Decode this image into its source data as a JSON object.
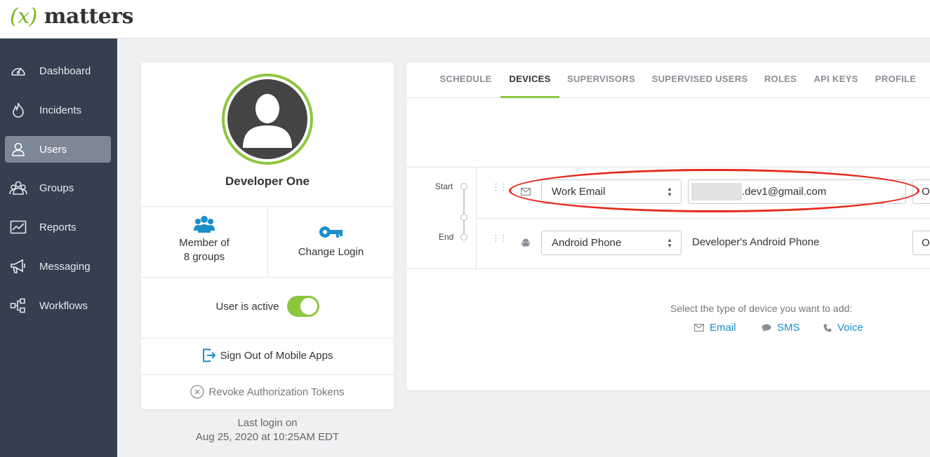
{
  "brand": {
    "logo_prefix": "(x)",
    "logo_text": "matters",
    "accent_color": "#8cc63f"
  },
  "sidebar": {
    "items": [
      {
        "label": "Dashboard",
        "icon": "dashboard-icon",
        "active": false
      },
      {
        "label": "Incidents",
        "icon": "flame-icon",
        "active": false
      },
      {
        "label": "Users",
        "icon": "user-icon",
        "active": true
      },
      {
        "label": "Groups",
        "icon": "groups-icon",
        "active": false
      },
      {
        "label": "Reports",
        "icon": "chart-icon",
        "active": false
      },
      {
        "label": "Messaging",
        "icon": "megaphone-icon",
        "active": false
      },
      {
        "label": "Workflows",
        "icon": "workflow-icon",
        "active": false
      }
    ]
  },
  "profile": {
    "name": "Developer One",
    "groups_line1": "Member of",
    "groups_line2": "8 groups",
    "change_login": "Change Login",
    "active_label": "User is active",
    "active": true,
    "sign_out_mobile": "Sign Out of Mobile Apps",
    "revoke_tokens": "Revoke Authorization Tokens",
    "last_login_line1": "Last login on",
    "last_login_line2": "Aug 25, 2020 at 10:25AM EDT"
  },
  "tabs": [
    {
      "label": "SCHEDULE",
      "active": false
    },
    {
      "label": "DEVICES",
      "active": true
    },
    {
      "label": "SUPERVISORS",
      "active": false
    },
    {
      "label": "SUPERVISED USERS",
      "active": false
    },
    {
      "label": "ROLES",
      "active": false
    },
    {
      "label": "API KEYS",
      "active": false
    },
    {
      "label": "PROFILE",
      "active": false
    }
  ],
  "timeline": {
    "start_label": "Start",
    "end_label": "End"
  },
  "devices": [
    {
      "type": "Work Email",
      "icon": "envelope-icon",
      "value": ".dev1@gmail.com",
      "value_redacted_prefix": true,
      "trailing": "O"
    },
    {
      "type": "Android Phone",
      "icon": "android-icon",
      "value": "Developer's Android Phone",
      "trailing": "O"
    }
  ],
  "add_device": {
    "prompt": "Select the type of device you want to add:",
    "options": [
      {
        "label": "Email",
        "icon": "envelope-icon"
      },
      {
        "label": "SMS",
        "icon": "chat-bubble-icon"
      },
      {
        "label": "Voice",
        "icon": "phone-icon"
      }
    ]
  }
}
